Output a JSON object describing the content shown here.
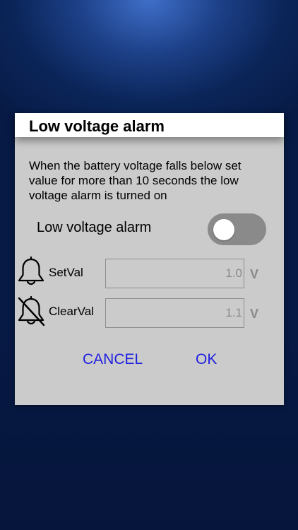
{
  "dialog": {
    "title": "Low voltage alarm",
    "description": "When the battery voltage falls below set value for more than 10 seconds the low voltage alarm is turned on",
    "toggle_label": "Low voltage alarm",
    "toggle_on": false,
    "rows": [
      {
        "label": "SetVal",
        "value": "1.0",
        "unit": "V",
        "icon": "bell-icon"
      },
      {
        "label": "ClearVal",
        "value": "1.1",
        "unit": "V",
        "icon": "bell-off-icon"
      }
    ],
    "cancel_label": "CANCEL",
    "ok_label": "OK"
  },
  "colors": {
    "accent": "#1f1fe0",
    "dialog_bg": "#cbcbcb",
    "toggle_off": "#8a8a8a"
  }
}
